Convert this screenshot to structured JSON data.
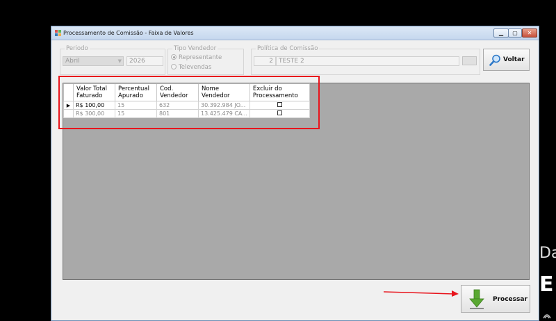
{
  "window": {
    "title": "Processamento de Comissão - Faixa de Valores",
    "controls": {
      "minimize": "▁",
      "maximize": "▢",
      "close": "✕"
    }
  },
  "periodo": {
    "legend": "Periodo",
    "month": "Abril",
    "year": "2026"
  },
  "tipo_vendedor": {
    "legend": "Tipo Vendedor",
    "options": [
      "Representante",
      "Televendas"
    ],
    "selected": "Representante"
  },
  "politica": {
    "legend": "Política de Comissão",
    "code": "2",
    "name": "TESTE 2"
  },
  "buttons": {
    "voltar": "Voltar",
    "processar": "Processar"
  },
  "grid": {
    "headers": [
      "Valor Total\nFaturado",
      "Percentual\nApurado",
      "Cod.\nVendedor",
      "Nome\nVendedor",
      "Excluir do\nProcessamento"
    ],
    "rows": [
      {
        "valor": "R$ 100,00",
        "percentual": "15",
        "cod": "632",
        "nome": "30.392.984 JO...",
        "excluir": false,
        "selected": true
      },
      {
        "valor": "R$ 300,00",
        "percentual": "15",
        "cod": "801",
        "nome": "13.425.479 CA...",
        "excluir": false,
        "selected": false
      }
    ]
  },
  "background_text": {
    "line1": "Da",
    "line2": "E"
  },
  "colors": {
    "annotation": "#e8141c",
    "grid_bg": "#a9a9a9",
    "accent": "#4f9a2b"
  },
  "icons": {
    "search": "magnifier-icon",
    "process": "down-arrow-icon"
  }
}
